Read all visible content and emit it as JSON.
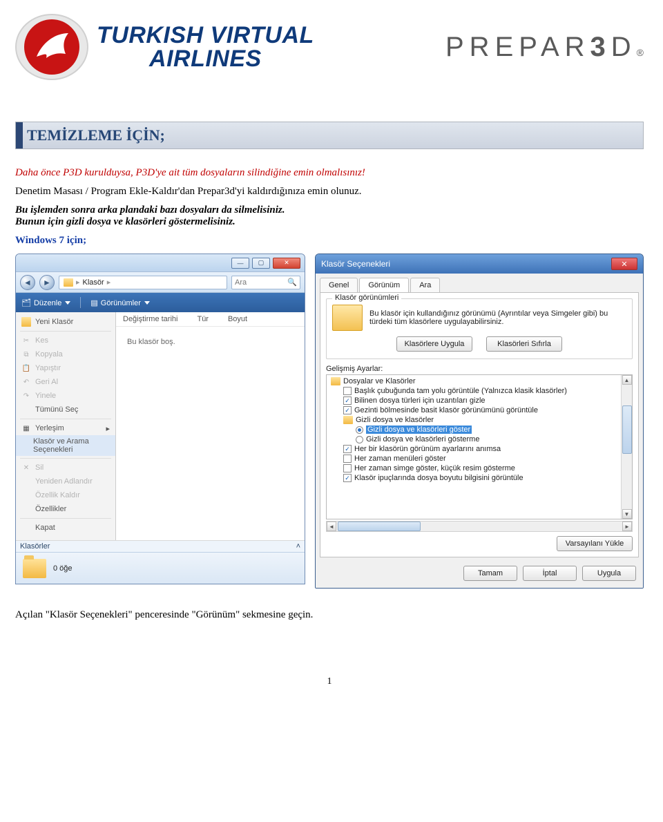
{
  "header": {
    "brand1_line1": "TURKISH VIRTUAL",
    "brand1_line2": "AIRLINES",
    "brand2": "PREPAR",
    "brand2_3": "3",
    "brand2_d": "D",
    "brand2_reg": "®"
  },
  "section_title": "TEMİZLEME İÇİN;",
  "p1": "Daha önce P3D kurulduysa, P3D'ye ait tüm dosyaların silindiğine emin olmalısınız!",
  "p2": "Denetim Masası / Program Ekle-Kaldır'dan Prepar3d'yi kaldırdığınıza emin olunuz.",
  "p3a": "Bu işlemden sonra arka plandaki bazı dosyaları da silmelisiniz.",
  "p3b": "Bunun için gizli dosya ve klasörleri göstermelisiniz.",
  "p4": "Windows 7 için;",
  "p5": "Açılan \"Klasör Seçenekleri\" penceresinde \"Görünüm\" sekmesine geçin.",
  "page_number": "1",
  "explorer": {
    "breadcrumb_root": "Klasör",
    "search_placeholder": "Ara",
    "toolbar": {
      "duzenle": "Düzenle",
      "gorunumler": "Görünümler"
    },
    "columns": {
      "c1": "Değiştirme tarihi",
      "c2": "Tür",
      "c3": "Boyut"
    },
    "empty": "Bu klasör boş.",
    "klasorler": "Klasörler",
    "status": "0 öğe",
    "ctx": {
      "yeni": "Yeni Klasör",
      "kes": "Kes",
      "kopyala": "Kopyala",
      "yapistir": "Yapıştır",
      "gerial": "Geri Al",
      "yinele": "Yinele",
      "tumunu": "Tümünü Seç",
      "yerlesim": "Yerleşim",
      "klasorarama": "Klasör ve Arama Seçenekleri",
      "sil": "Sil",
      "yeniden": "Yeniden Adlandır",
      "ozellikk": "Özellik Kaldır",
      "ozellikler": "Özellikler",
      "kapat": "Kapat"
    }
  },
  "dlg": {
    "title": "Klasör Seçenekleri",
    "tabs": {
      "genel": "Genel",
      "gorunum": "Görünüm",
      "ara": "Ara"
    },
    "gv_group": "Klasör görünümleri",
    "gv_text": "Bu klasör için kullandığınız görünümü (Ayrıntılar veya Simgeler gibi) bu türdeki tüm klasörlere uygulayabilirsiniz.",
    "btn_apply_folders": "Klasörlere Uygula",
    "btn_reset_folders": "Klasörleri Sıfırla",
    "adv_label": "Gelişmiş Ayarlar:",
    "tree": {
      "root": "Dosyalar ve Klasörler",
      "n1": "Başlık çubuğunda tam yolu görüntüle (Yalnızca klasik klasörler)",
      "n2": "Bilinen dosya türleri için uzantıları gizle",
      "n3": "Gezinti bölmesinde basit klasör görünümünü görüntüle",
      "n4": "Gizli dosya ve klasörler",
      "n4a": "Gizli dosya ve klasörleri göster",
      "n4b": "Gizli dosya ve klasörleri gösterme",
      "n5": "Her bir klasörün görünüm ayarlarını anımsa",
      "n6": "Her zaman menüleri göster",
      "n7": "Her zaman simge göster, küçük resim gösterme",
      "n8": "Klasör ipuçlarında dosya boyutu bilgisini görüntüle"
    },
    "btn_restore": "Varsayılanı Yükle",
    "btn_ok": "Tamam",
    "btn_cancel": "İptal",
    "btn_apply": "Uygula"
  }
}
